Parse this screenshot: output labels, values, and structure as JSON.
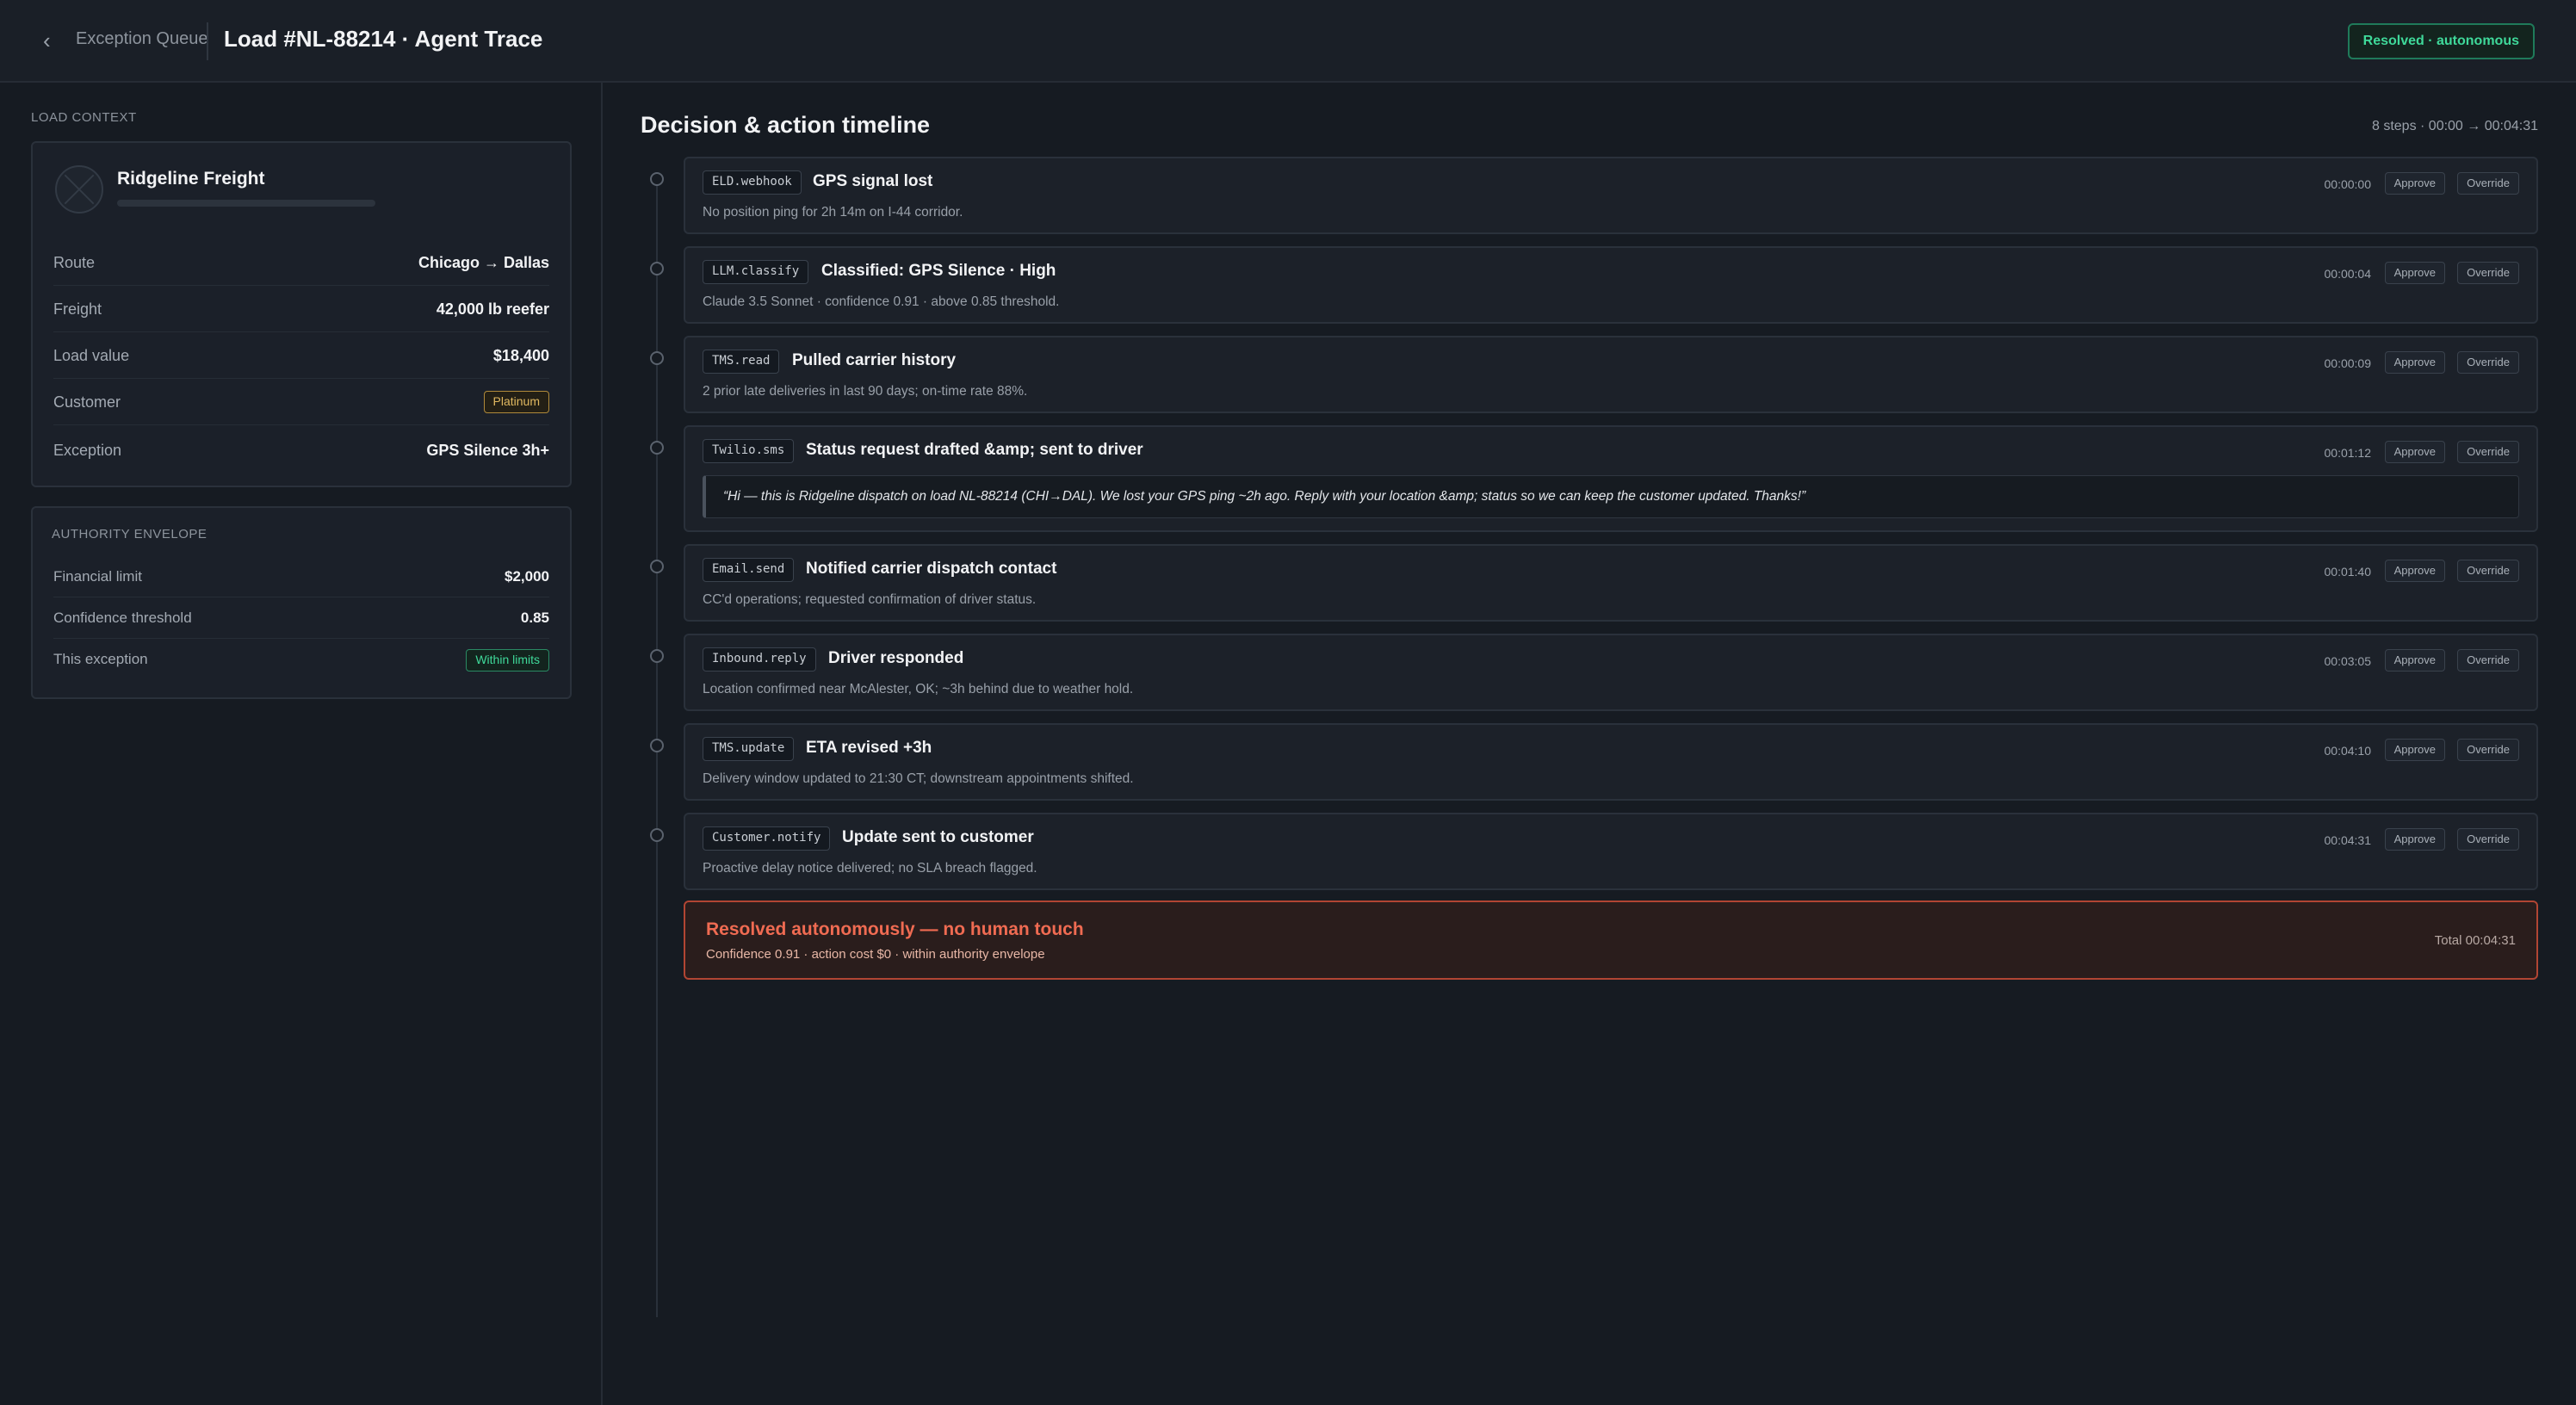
{
  "header": {
    "back_label": "Exception Queue",
    "title": "Load #NL-88214 · Agent Trace",
    "status": "Resolved · autonomous"
  },
  "load_context": {
    "section_label": "LOAD CONTEXT",
    "carrier_name": "Ridgeline Freight",
    "rows": {
      "route": {
        "key": "Route",
        "value": "Chicago → Dallas"
      },
      "freight": {
        "key": "Freight",
        "value": "42,000 lb reefer"
      },
      "load_value": {
        "key": "Load value",
        "value": "$18,400"
      },
      "customer": {
        "key": "Customer",
        "value": "Platinum"
      },
      "exception": {
        "key": "Exception",
        "value": "GPS Silence 3h+"
      }
    }
  },
  "authority": {
    "section_label": "AUTHORITY ENVELOPE",
    "financial": {
      "key": "Financial limit",
      "value": "$2,000"
    },
    "confidence": {
      "key": "Confidence threshold",
      "value": "0.85"
    },
    "this_exception": {
      "key": "This exception",
      "value": "Within limits"
    }
  },
  "timeline": {
    "title": "Decision & action timeline",
    "meta": "8 steps · 00:00 → 00:04:31",
    "approve_label": "Approve",
    "override_label": "Override",
    "steps": [
      {
        "tool": "ELD.webhook",
        "title": "GPS signal lost",
        "desc": "No position ping for 2h 14m on I-44 corridor.",
        "time": "00:00:00"
      },
      {
        "tool": "LLM.classify",
        "title": "Classified: GPS Silence · High",
        "desc": "Claude 3.5 Sonnet · confidence 0.91 · above 0.85 threshold.",
        "time": "00:00:04"
      },
      {
        "tool": "TMS.read",
        "title": "Pulled carrier history",
        "desc": "2 prior late deliveries in last 90 days; on-time rate 88%.",
        "time": "00:00:09"
      },
      {
        "tool": "Twilio.sms",
        "title": "Status request drafted &amp; sent to driver",
        "desc": "“Hi — this is Ridgeline dispatch on load NL-88214 (CHI→DAL). We lost your GPS ping ~2h ago. Reply with your location &amp; status so we can keep the customer updated. Thanks!”",
        "time": "00:01:12"
      },
      {
        "tool": "Email.send",
        "title": "Notified carrier dispatch contact",
        "desc": "CC'd operations; requested confirmation of driver status.",
        "time": "00:01:40"
      },
      {
        "tool": "Inbound.reply",
        "title": "Driver responded",
        "desc": "Location confirmed near McAlester, OK; ~3h behind due to weather hold.",
        "time": "00:03:05"
      },
      {
        "tool": "TMS.update",
        "title": "ETA revised +3h",
        "desc": "Delivery window updated to 21:30 CT; downstream appointments shifted.",
        "time": "00:04:10"
      },
      {
        "tool": "Customer.notify",
        "title": "Update sent to customer",
        "desc": "Proactive delay notice delivered; no SLA breach flagged.",
        "time": "00:04:31"
      }
    ],
    "resolved": {
      "title": "Resolved autonomously — no human touch",
      "sub": "Confidence 0.91 · action cost $0 · within authority envelope",
      "total": "Total 00:04:31"
    }
  }
}
